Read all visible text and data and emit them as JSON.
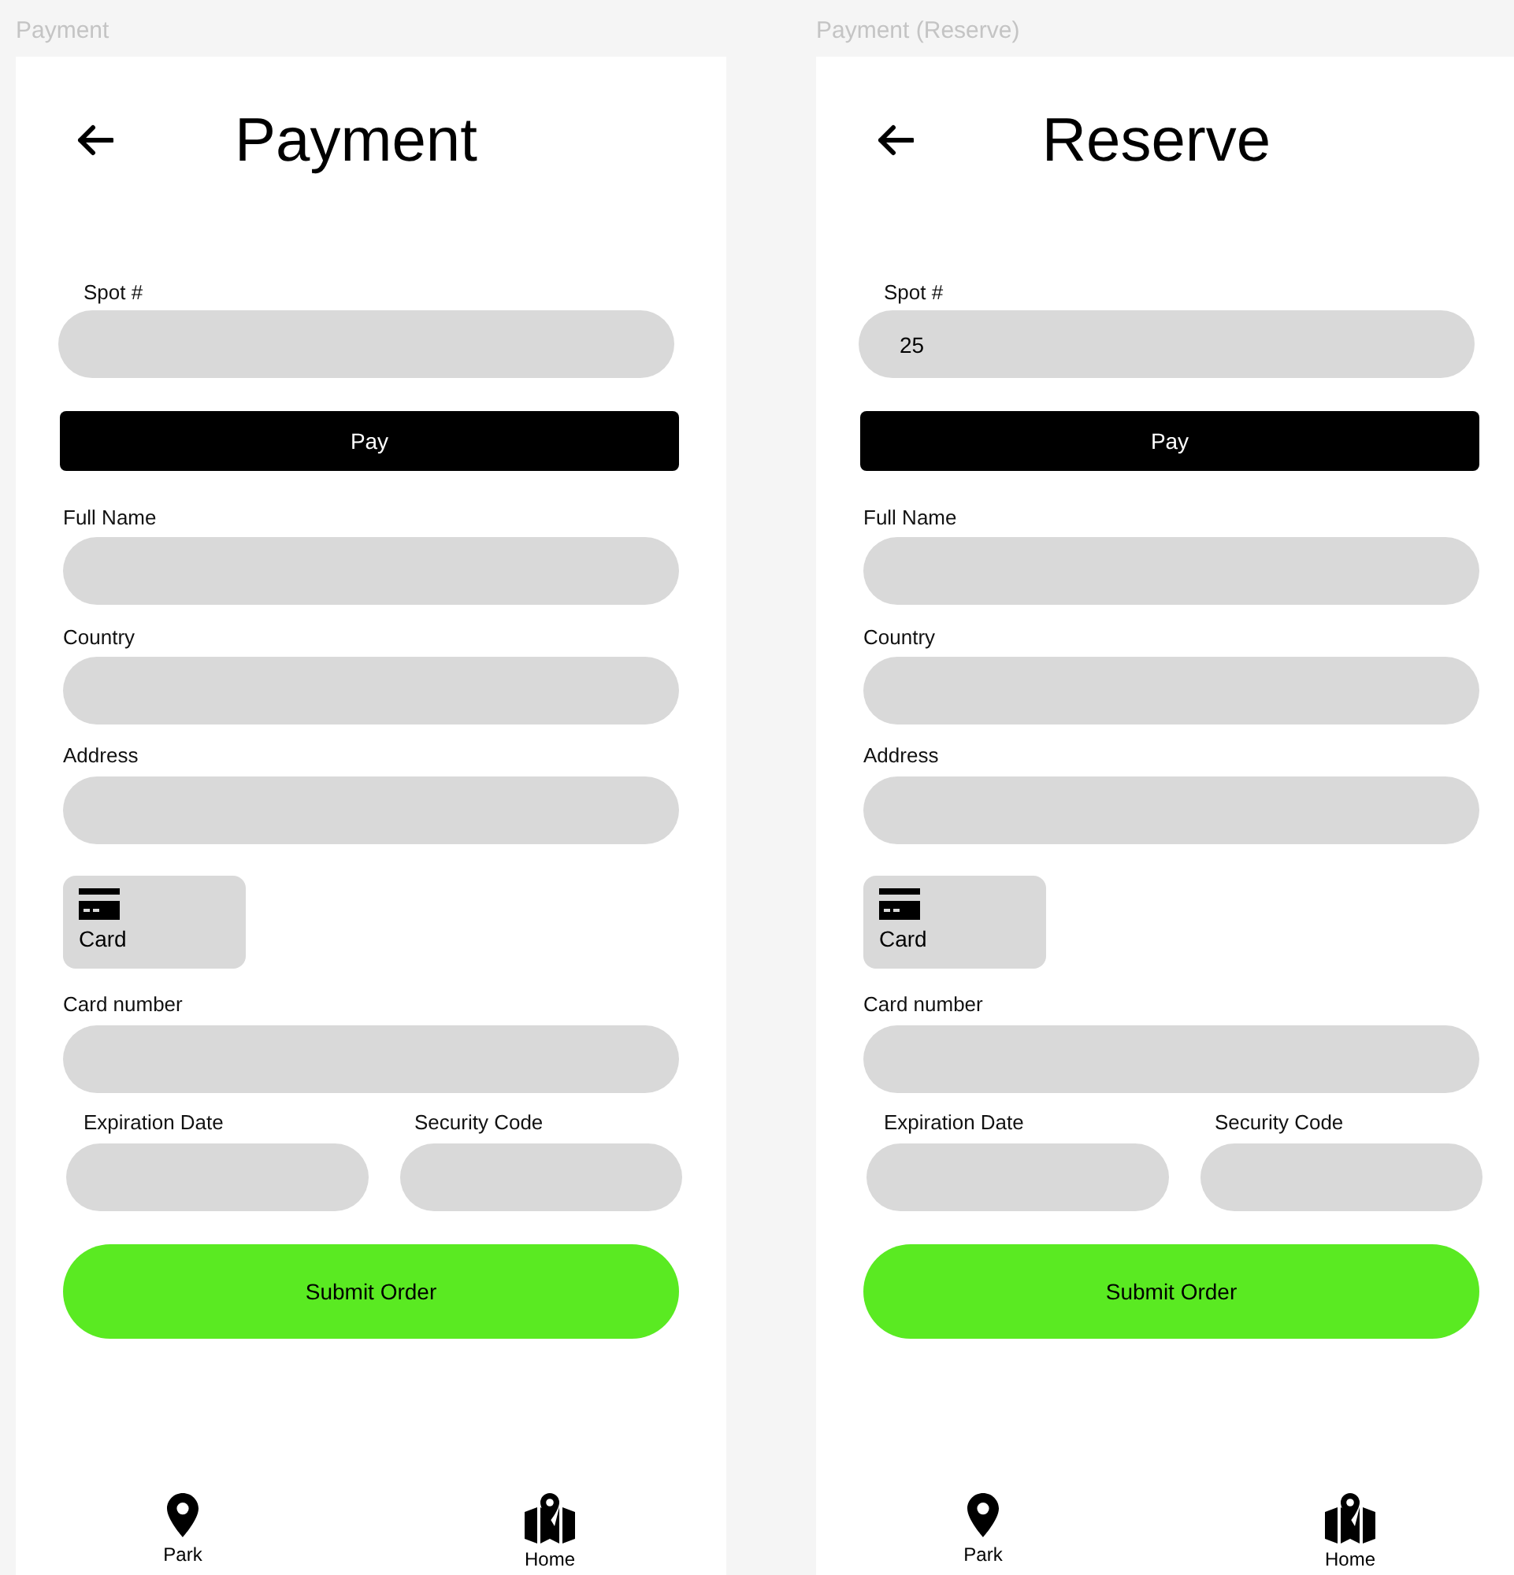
{
  "frames": [
    {
      "frame_label": "Payment",
      "title": "Payment",
      "spot": {
        "label": "Spot #"
      },
      "pay_button": "Pay",
      "fields": [
        {
          "label": "Full Name"
        },
        {
          "label": "Country"
        },
        {
          "label": "Address"
        }
      ],
      "payment_option": {
        "label": "Card"
      },
      "card_number": {
        "label": "Card number"
      },
      "expiration": {
        "label": "Expiration Date"
      },
      "security_code": {
        "label": "Security Code"
      },
      "submit_button": "Submit Order",
      "nav": [
        {
          "kind": "pin",
          "label": "Park"
        },
        {
          "kind": "map",
          "label": "Home"
        }
      ]
    },
    {
      "frame_label": "Payment (Reserve)",
      "title": "Reserve",
      "spot": {
        "label": "Spot #",
        "value": "25"
      },
      "pay_button": "Pay",
      "fields": [
        {
          "label": "Full Name"
        },
        {
          "label": "Country"
        },
        {
          "label": "Address"
        }
      ],
      "payment_option": {
        "label": "Card"
      },
      "card_number": {
        "label": "Card number"
      },
      "expiration": {
        "label": "Expiration Date"
      },
      "security_code": {
        "label": "Security Code"
      },
      "submit_button": "Submit Order",
      "nav": [
        {
          "kind": "pin",
          "label": "Park"
        },
        {
          "kind": "map",
          "label": "Home"
        }
      ]
    }
  ]
}
